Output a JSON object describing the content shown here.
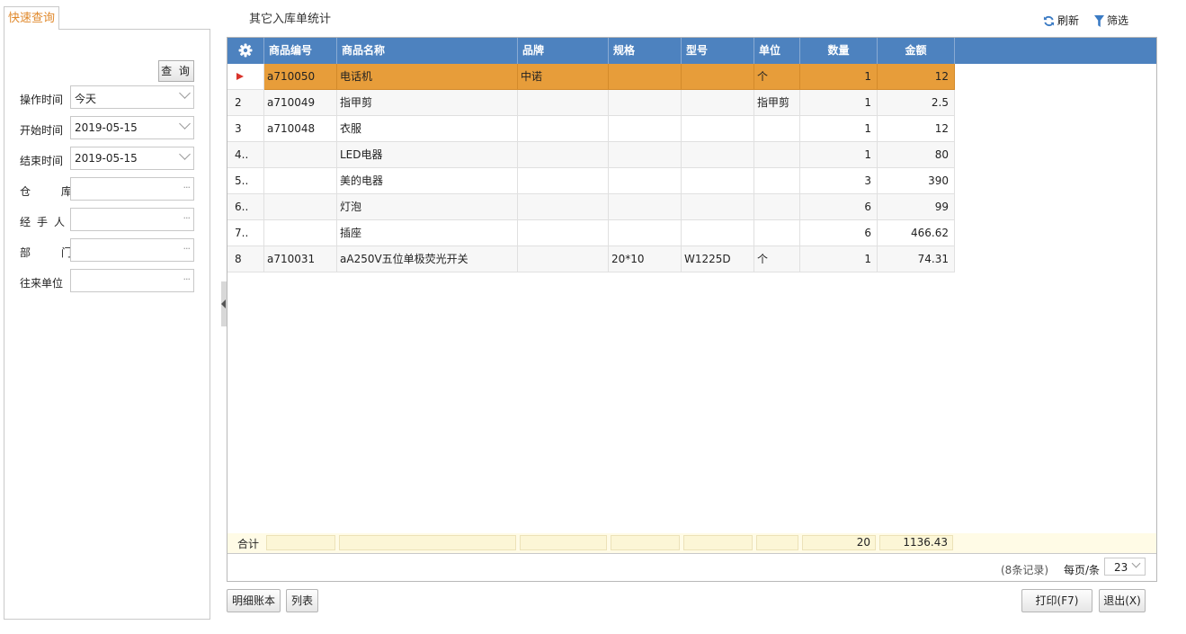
{
  "left": {
    "tab": "快速查询",
    "query_button": "查 询",
    "fields": [
      {
        "label": "操作时间",
        "value": "今天",
        "type": "select"
      },
      {
        "label": "开始时间",
        "value": "2019-05-15",
        "type": "date"
      },
      {
        "label": "结束时间",
        "value": "2019-05-15",
        "type": "date"
      },
      {
        "label": "仓 库",
        "value": "",
        "type": "picker"
      },
      {
        "label": "经手人",
        "value": "",
        "type": "picker"
      },
      {
        "label": "部 门",
        "value": "",
        "type": "picker"
      },
      {
        "label": "往来单位",
        "value": "",
        "type": "picker"
      }
    ]
  },
  "title": "其它入库单统计",
  "toolbar": {
    "refresh": "刷新",
    "filter": "筛选"
  },
  "grid": {
    "columns": [
      "商品编号",
      "商品名称",
      "品牌",
      "规格",
      "型号",
      "单位",
      "数量",
      "金额"
    ],
    "rows": [
      {
        "idx": "",
        "code": "a710050",
        "name": "电话机",
        "brand": "中诺",
        "spec": "",
        "model": "",
        "unit": "个",
        "qty": "1",
        "amount": "12"
      },
      {
        "idx": "2",
        "code": "a710049",
        "name": "指甲剪",
        "brand": "",
        "spec": "",
        "model": "",
        "unit": "指甲剪",
        "qty": "1",
        "amount": "2.5"
      },
      {
        "idx": "3",
        "code": "a710048",
        "name": "衣服",
        "brand": "",
        "spec": "",
        "model": "",
        "unit": "",
        "qty": "1",
        "amount": "12"
      },
      {
        "idx": "4..",
        "code": "",
        "name": "LED电器",
        "brand": "",
        "spec": "",
        "model": "",
        "unit": "",
        "qty": "1",
        "amount": "80"
      },
      {
        "idx": "5..",
        "code": "",
        "name": "美的电器",
        "brand": "",
        "spec": "",
        "model": "",
        "unit": "",
        "qty": "3",
        "amount": "390"
      },
      {
        "idx": "6..",
        "code": "",
        "name": "灯泡",
        "brand": "",
        "spec": "",
        "model": "",
        "unit": "",
        "qty": "6",
        "amount": "99"
      },
      {
        "idx": "7..",
        "code": "",
        "name": "插座",
        "brand": "",
        "spec": "",
        "model": "",
        "unit": "",
        "qty": "6",
        "amount": "466.62"
      },
      {
        "idx": "8",
        "code": "a710031",
        "name": "aA250V五位单极荧光开关",
        "brand": "",
        "spec": "20*10",
        "model": "W1225D",
        "unit": "个",
        "qty": "1",
        "amount": "74.31"
      }
    ],
    "summary": {
      "label": "合计",
      "qty": "20",
      "amount": "1136.43"
    },
    "records": "(8条记录)",
    "per_page_label": "每页/条",
    "per_page": "23"
  },
  "buttons": {
    "detail_ledger": "明细账本",
    "list": "列表",
    "print": "打印(F7)",
    "exit": "退出(X)"
  },
  "colors": {
    "header": "#4d82bf",
    "selected_row": "#e79d3a",
    "tab_text": "#e0892c"
  }
}
